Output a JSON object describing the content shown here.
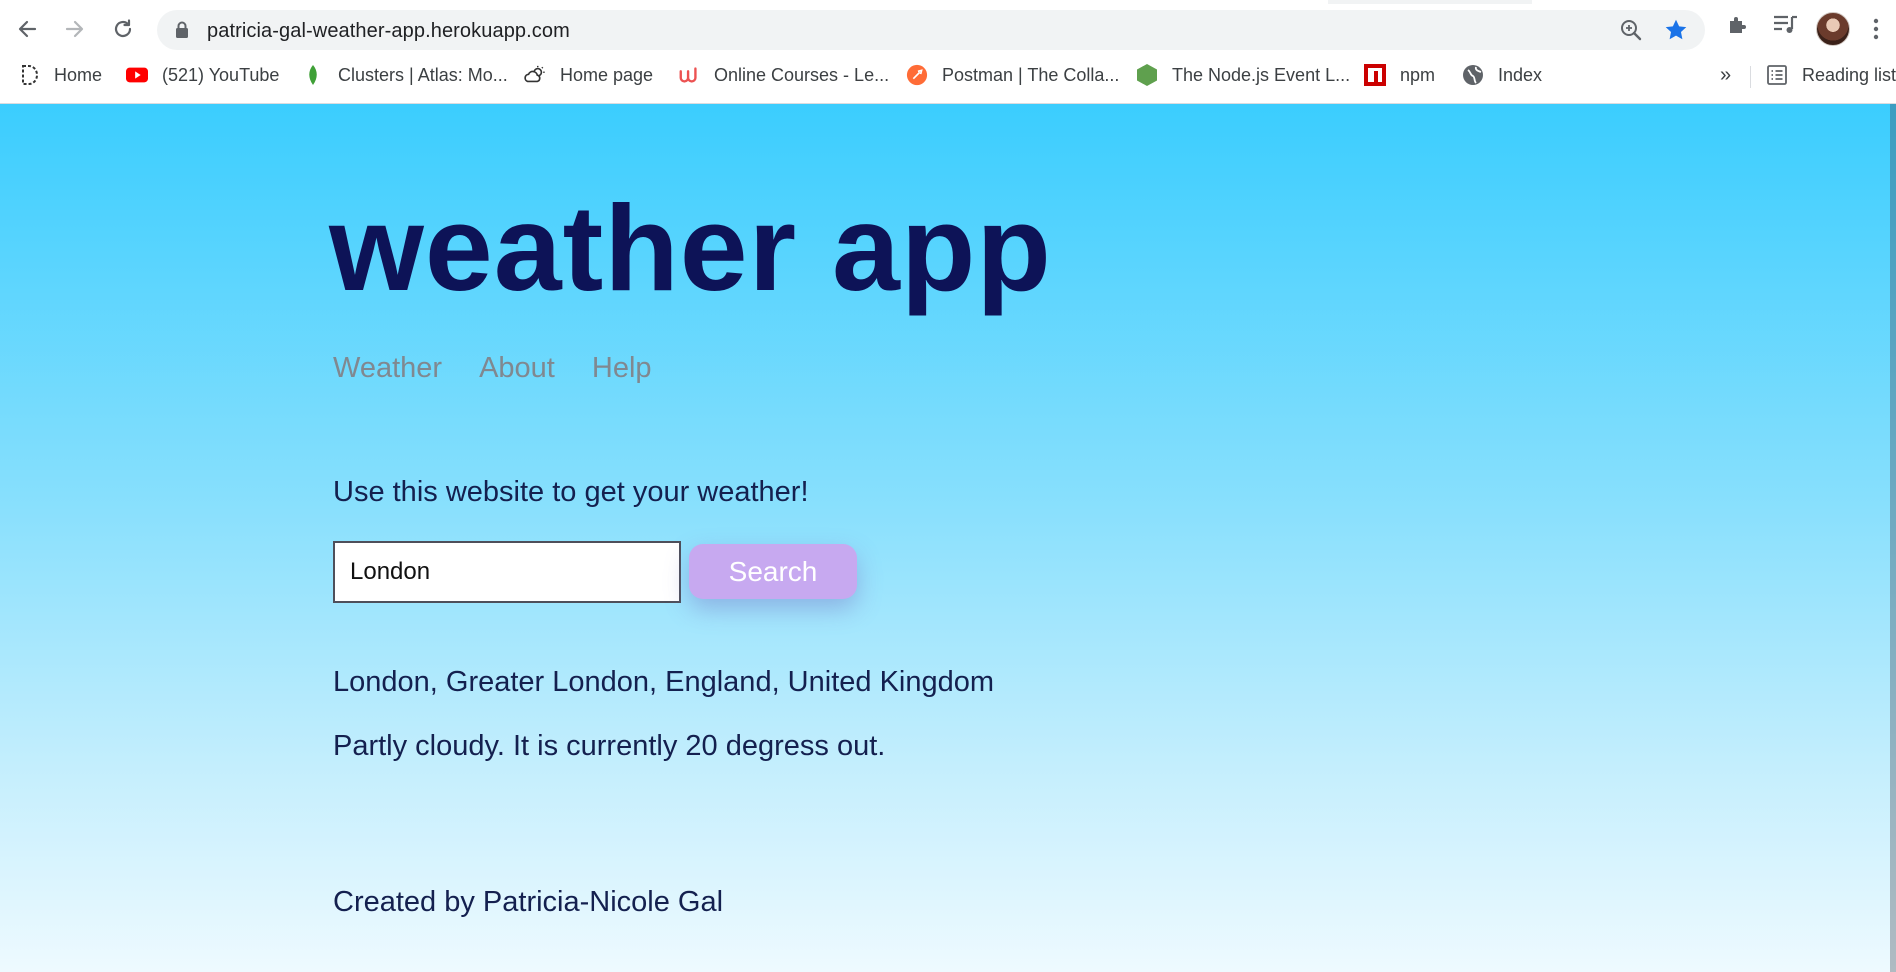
{
  "browser": {
    "url": "patricia-gal-weather-app.herokuapp.com",
    "bookmarks": [
      {
        "label": "Home",
        "icon": "dev-icon"
      },
      {
        "label": "(521) YouTube",
        "icon": "youtube-icon"
      },
      {
        "label": "Clusters | Atlas: Mo...",
        "icon": "mongodb-leaf-icon"
      },
      {
        "label": "Home page",
        "icon": "weather-cloud-icon"
      },
      {
        "label": "Online Courses - Le...",
        "icon": "udemy-icon"
      },
      {
        "label": "Postman | The Colla...",
        "icon": "postman-icon"
      },
      {
        "label": "The Node.js Event L...",
        "icon": "nodejs-hexagon-icon"
      },
      {
        "label": "npm",
        "icon": "npm-icon"
      },
      {
        "label": "Index",
        "icon": "globe-icon"
      }
    ],
    "overflow_label": "»",
    "reading_list_label": "Reading list"
  },
  "page": {
    "title": "weather app",
    "nav": [
      "Weather",
      "About",
      "Help"
    ],
    "intro": "Use this website to get your weather!",
    "search": {
      "value": "London",
      "button_label": "Search"
    },
    "location": "London, Greater London, England, United Kingdom",
    "forecast": "Partly cloudy. It is currently 20 degress out.",
    "footer": "Created by Patricia-Nicole Gal"
  },
  "colors": {
    "title": "#0d1357",
    "nav": "#808890",
    "button": "#c7a9f0",
    "gradient_top": "#3bcdfe",
    "gradient_bottom": "#eefaff",
    "star": "#1a73e8"
  }
}
